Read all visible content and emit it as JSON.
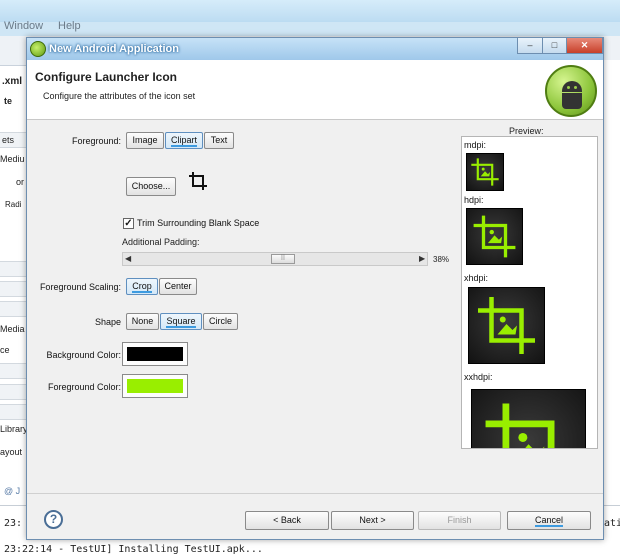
{
  "ide": {
    "menu": [
      "Window",
      "Help"
    ],
    "left_fragments": [
      ".xml",
      "te",
      "ets",
      "Mediu",
      "or",
      "Radi",
      "Media",
      "ce",
      "Library",
      "ayout",
      "@ J"
    ],
    "right_fragments": [
      "ati"
    ],
    "console_lines": [
      "23:",
      "23:22:14 - TestUI] Installing TestUI.apk..."
    ]
  },
  "dialog": {
    "window_title": "New Android Application",
    "window_buttons": [
      "–",
      "□",
      "✕"
    ],
    "header_title": "Configure Launcher Icon",
    "header_subtitle": "Configure the attributes of the icon set",
    "foreground_label": "Foreground:",
    "foreground_options": [
      "Image",
      "Clipart",
      "Text"
    ],
    "foreground_selected": "Clipart",
    "choose_button": "Choose...",
    "trim_label": "Trim Surrounding Blank Space",
    "trim_checked": true,
    "padding_label": "Additional Padding:",
    "padding_value": "38",
    "padding_unit": "%",
    "scaling_label": "Foreground Scaling:",
    "scaling_options": [
      "Crop",
      "Center"
    ],
    "scaling_selected": "Crop",
    "shape_label": "Shape",
    "shape_options": [
      "None",
      "Square",
      "Circle"
    ],
    "shape_selected": "Square",
    "bg_color_label": "Background Color:",
    "bg_color": "#000000",
    "fg_color_label": "Foreground Color:",
    "fg_color": "#99ee00",
    "preview_label": "Preview:",
    "densities": [
      "mdpi:",
      "hdpi:",
      "xhdpi:",
      "xxhdpi:"
    ],
    "help_glyph": "?",
    "nav": {
      "back": "< Back",
      "next": "Next >",
      "finish": "Finish",
      "cancel": "Cancel"
    }
  }
}
